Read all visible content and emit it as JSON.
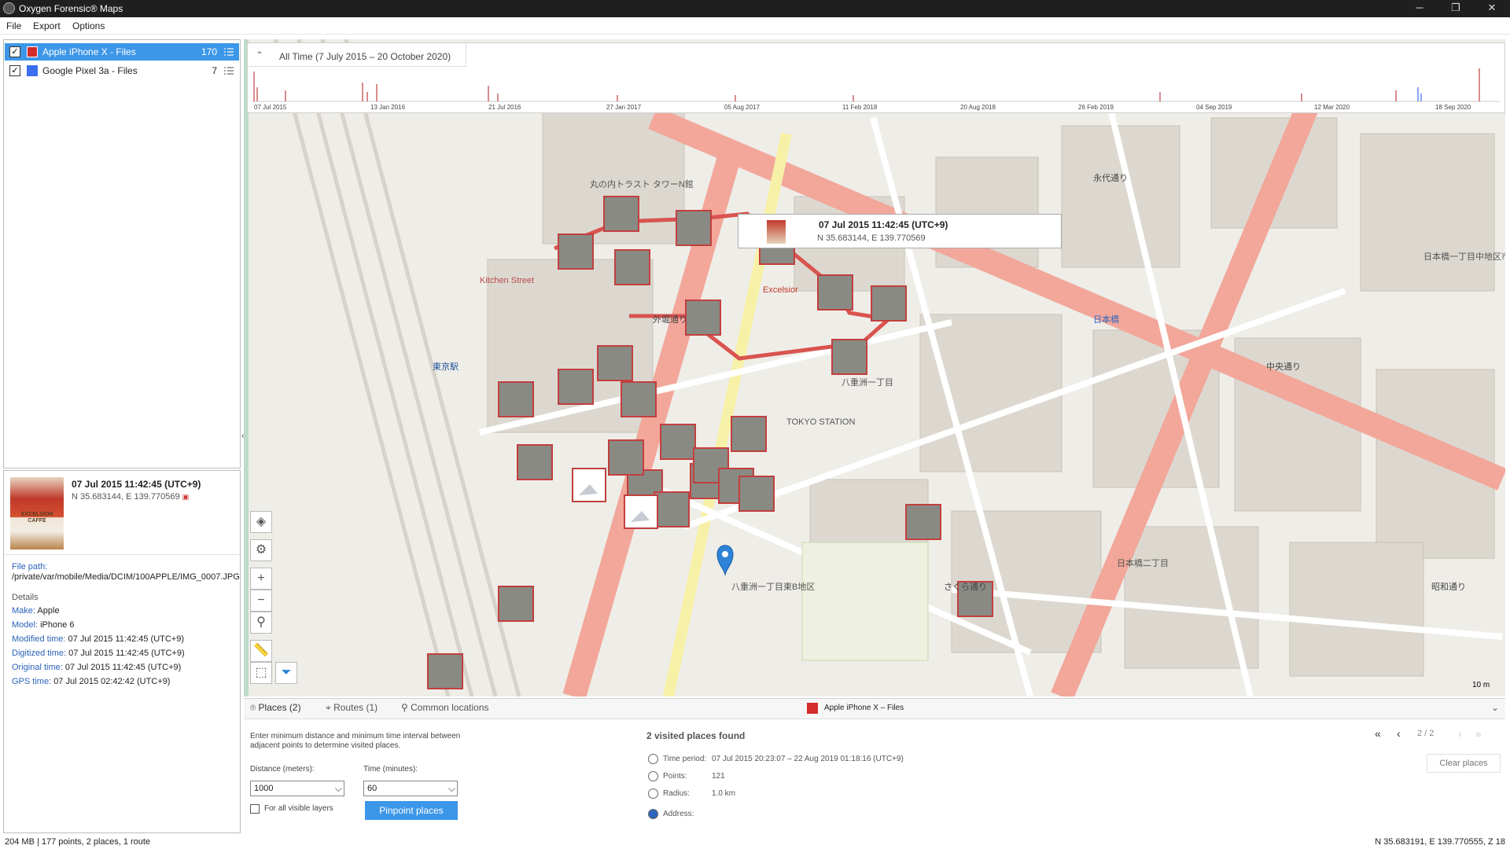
{
  "window": {
    "title": "Oxygen Forensic® Maps",
    "min": "─",
    "max": "❐",
    "close": "✕"
  },
  "menu": [
    "File",
    "Export",
    "Options"
  ],
  "layers": [
    {
      "name": "Apple iPhone X - Files",
      "count": "170",
      "color": "#d42b2b",
      "checked": "✓"
    },
    {
      "name": "Google Pixel 3a - Files",
      "count": "7",
      "color": "#3b6ff0",
      "checked": "✓"
    }
  ],
  "timeline": {
    "chevron": "⌃",
    "range": "All Time (7 July 2015 – 20 October 2020)",
    "ticks": [
      "07 Jul 2015",
      "13 Jan 2016",
      "21 Jul 2016",
      "27 Jan 2017",
      "05 Aug 2017",
      "11 Feb 2018",
      "20 Aug 2018",
      "26 Feb 2019",
      "04 Sep 2019",
      "12 Mar 2020",
      "18 Sep 2020"
    ]
  },
  "tooltip": {
    "timestamp": "07 Jul 2015  11:42:45  (UTC+9)",
    "coords": "N 35.683144, E 139.770569"
  },
  "details": {
    "timestamp": "07 Jul 2015  11:42:45  (UTC+9)",
    "coords": "N 35.683144, E 139.770569",
    "cup_text": "EXCELSIOR CAFFE",
    "file_path_label": "File path:",
    "file_path": "/private/var/mobile/Media/DCIM/100APPLE/IMG_0007.JPG",
    "details_header": "Details",
    "fields": [
      {
        "k": "Make:",
        "v": "Apple"
      },
      {
        "k": "Model:",
        "v": "iPhone 6"
      },
      {
        "k": "Modified time:",
        "v": "07 Jul 2015 11:42:45 (UTC+9)"
      },
      {
        "k": "Digitized time:",
        "v": "07 Jul 2015 11:42:45 (UTC+9)"
      },
      {
        "k": "Original time:",
        "v": "07 Jul 2015 11:42:45 (UTC+9)"
      },
      {
        "k": "GPS time:",
        "v": "07 Jul 2015 02:42:42 (UTC+9)"
      }
    ]
  },
  "map_tools": [
    "layers-icon",
    "gear-icon",
    "zoom-in-icon",
    "zoom-out-icon",
    "zoom-search-icon",
    "ruler-icon",
    "select-area-icon",
    "filter-icon"
  ],
  "map_labels": [
    "八重洲一丁目",
    "丸の内トラスト タワーN館",
    "日本橋一丁目中地区市街地再開発",
    "八重洲一丁目東B地区",
    "永代通り",
    "外堀通り",
    "中央通り",
    "日本橋",
    "東京駅",
    "Kitchen Street",
    "Excelsior",
    "TOKYO STATION",
    "日本橋二丁目",
    "昭和通り",
    "さくら通り"
  ],
  "scale": "10 m",
  "bottom": {
    "tabs": [
      "Places (2)",
      "Routes (1)",
      "Common locations"
    ],
    "layer_name": "Apple iPhone X – Files",
    "hint": "Enter minimum distance and minimum time interval between adjacent points to determine visited places.",
    "distance_label": "Distance (meters):",
    "distance_value": "1000",
    "time_label": "Time (minutes):",
    "time_value": "60",
    "all_layers": "For all visible layers",
    "pinpoint": "Pinpoint places",
    "found": "2 visited places found",
    "time_period_k": "Time period:",
    "time_period_v": "07 Jul 2015  20:23:07  –  22 Aug 2019  01:18:16  (UTC+9)",
    "points_k": "Points:",
    "points_v": "121",
    "radius_k": "Radius:",
    "radius_v": "1.0 km",
    "address_k": "Address:",
    "pager": "2 / 2",
    "clear": "Clear places"
  },
  "status": {
    "left": "204 MB | 177 points, 2 places, 1 route",
    "right": "N 35.683191, E 139.770555, Z 18"
  }
}
